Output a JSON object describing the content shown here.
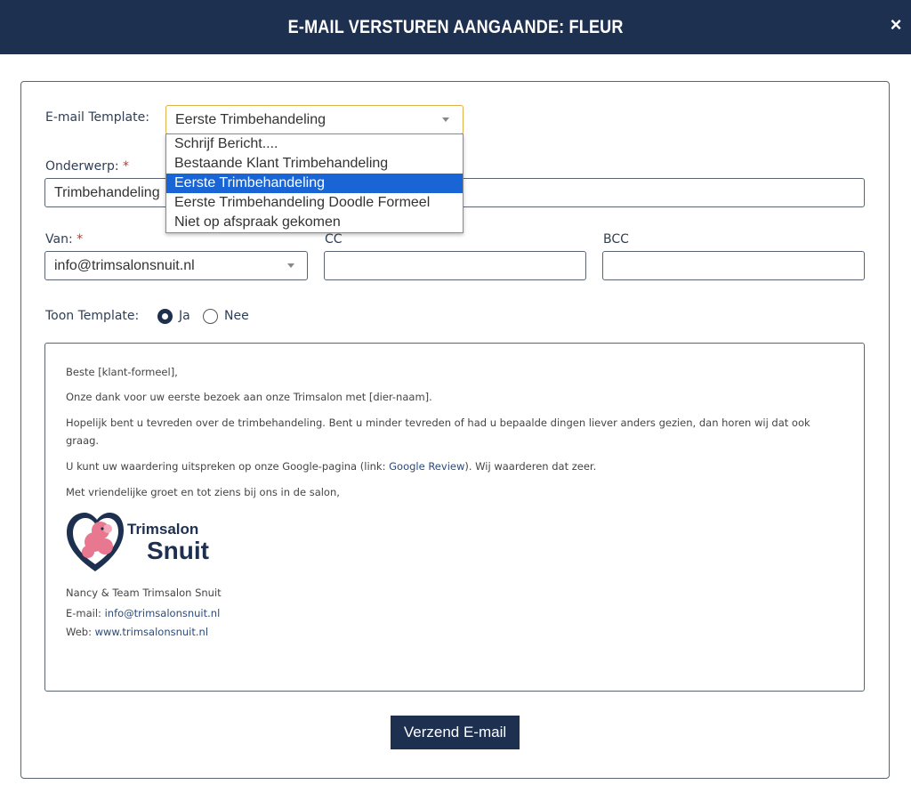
{
  "header": {
    "title": "E-MAIL VERSTUREN AANGAANDE: FLEUR",
    "close_label": "×"
  },
  "template": {
    "label": "E-mail Template:",
    "selected": "Eerste Trimbehandeling",
    "options": [
      "Schrijf Bericht....",
      "Bestaande Klant Trimbehandeling",
      "Eerste Trimbehandeling",
      "Eerste Trimbehandeling Doodle Formeel",
      "Niet op afspraak gekomen"
    ]
  },
  "subject": {
    "label": "Onderwerp:",
    "required_mark": "*",
    "value": "Trimbehandeling"
  },
  "from": {
    "label": "Van:",
    "required_mark": "*",
    "value": "info@trimsalonsnuit.nl"
  },
  "cc": {
    "label": "CC",
    "value": ""
  },
  "bcc": {
    "label": "BCC",
    "value": ""
  },
  "show_template": {
    "label": "Toon Template:",
    "yes": "Ja",
    "no": "Nee",
    "selected": "Ja"
  },
  "body": {
    "greeting": "Beste [klant-formeel],",
    "line1": "Onze dank voor uw eerste bezoek aan onze Trimsalon met [dier-naam].",
    "line2a": "Hopelijk bent u tevreden over de trimbehandeling. Bent u minder tevreden of had u bepaalde dingen liever anders gezien, dan horen wij dat ook",
    "line2b": "graag.",
    "line3_pre": "U kunt uw waardering uitspreken op onze Google-pagina (link: ",
    "line3_link": "Google Review",
    "line3_post": ").  Wij waarderen dat zeer.",
    "closing": "Met vriendelijke groet en tot ziens bij ons in de salon,",
    "logo_top": "Trimsalon",
    "logo_bottom": "Snuit",
    "signature": "Nancy & Team Trimsalon Snuit",
    "email_label": "E-mail: ",
    "email": "info@trimsalonsnuit.nl",
    "web_label": "Web: ",
    "web": "www.trimsalonsnuit.nl"
  },
  "send_button": "Verzend E-mail",
  "colors": {
    "navy": "#1e3050",
    "highlight": "#1a65d6",
    "required": "#c0392b",
    "logo_pink": "#e8788f"
  }
}
